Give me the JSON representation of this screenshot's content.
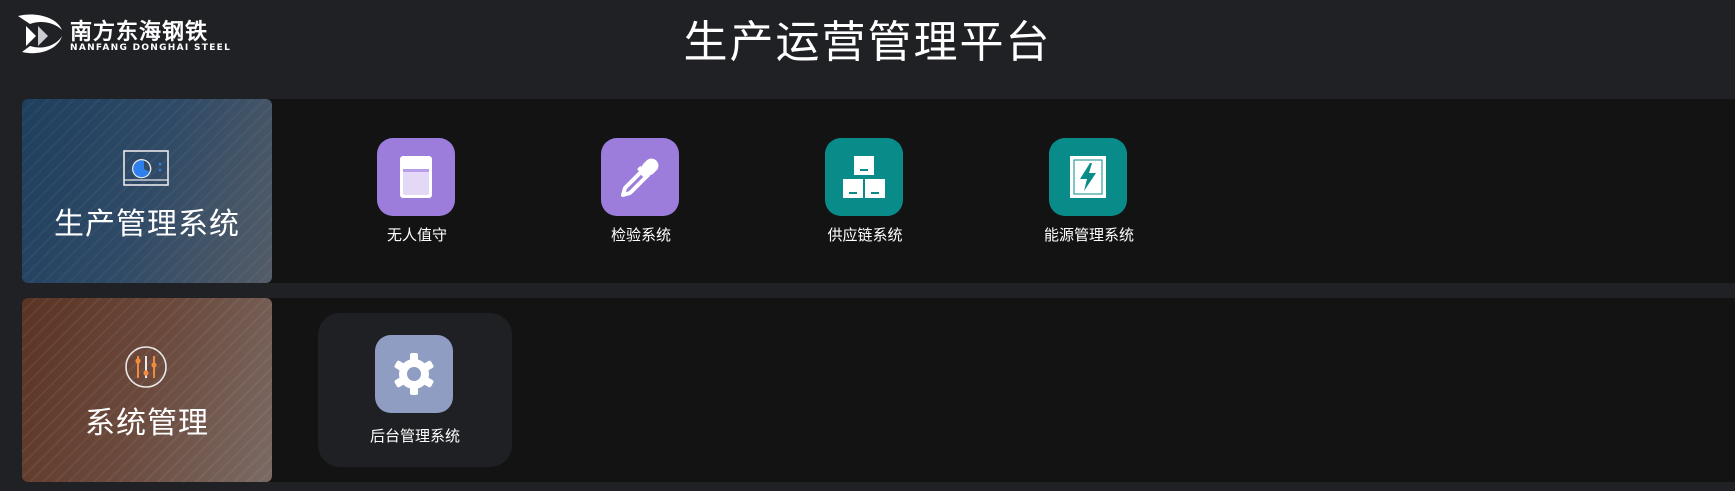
{
  "brand": {
    "name_cn": "南方东海钢铁",
    "name_en": "NANFANG DONGHAI STEEL",
    "logo_icon": "company-logo-icon"
  },
  "page_title": "生产运营管理平台",
  "colors": {
    "background": "#202124",
    "row_background": "#131313",
    "purple": "#9d7ddc",
    "teal": "#098b8a",
    "slate": "#8f9dc2",
    "accent_blue": "#2f80ed",
    "accent_orange": "#f08a3c"
  },
  "sections": [
    {
      "title": "生产管理系统",
      "icon": "chart-screen-icon",
      "apps": [
        {
          "label": "无人值守",
          "icon": "beaker-icon",
          "color": "purple"
        },
        {
          "label": "检验系统",
          "icon": "dropper-icon",
          "color": "purple"
        },
        {
          "label": "供应链系统",
          "icon": "boxes-icon",
          "color": "teal"
        },
        {
          "label": "能源管理系统",
          "icon": "energy-icon",
          "color": "teal"
        }
      ]
    },
    {
      "title": "系统管理",
      "icon": "sliders-icon",
      "apps": [
        {
          "label": "后台管理系统",
          "icon": "gear-icon",
          "color": "slate"
        }
      ]
    }
  ]
}
